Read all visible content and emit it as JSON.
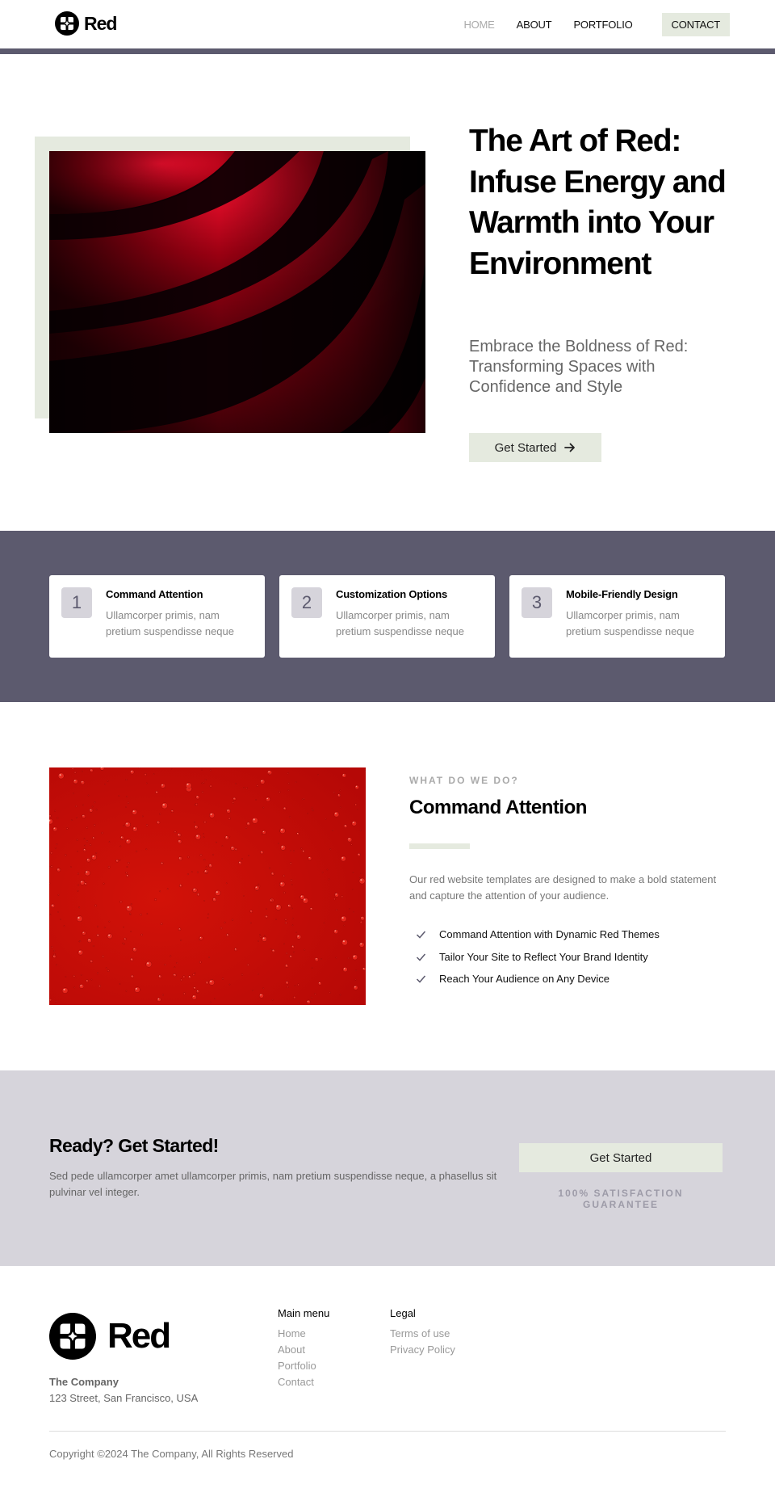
{
  "header": {
    "brand": "Red",
    "nav": [
      {
        "label": "HOME",
        "active": true
      },
      {
        "label": "ABOUT",
        "active": false
      },
      {
        "label": "PORTFOLIO",
        "active": false
      },
      {
        "label": "CONTACT",
        "active": false
      }
    ]
  },
  "hero": {
    "title": "The Art of Red: Infuse Energy and Warmth into Your Environment",
    "subtitle": "Embrace the Boldness of Red: Transforming Spaces with Confidence and Style",
    "cta_label": "Get Started",
    "cta_icon": "arrow-right-icon",
    "image": "abstract-red-curves"
  },
  "features": [
    {
      "number": "1",
      "title": "Command Attention",
      "description": "Ullamcorper primis, nam pretium suspendisse neque"
    },
    {
      "number": "2",
      "title": "Customization Options",
      "description": "Ullamcorper primis, nam pretium suspendisse neque"
    },
    {
      "number": "3",
      "title": "Mobile-Friendly Design",
      "description": "Ullamcorper primis, nam pretium suspendisse neque"
    }
  ],
  "about": {
    "image": "red-water-droplets",
    "eyebrow": "WHAT DO WE DO?",
    "title": "Command Attention",
    "text": "Our red website templates are designed to make a bold statement and capture the attention of your audience.",
    "checklist": [
      "Command Attention with Dynamic Red Themes",
      "Tailor Your Site to Reflect Your Brand Identity",
      "Reach Your Audience on Any Device"
    ]
  },
  "cta": {
    "title": "Ready? Get Started!",
    "text": "Sed pede ullamcorper amet ullamcorper primis, nam pretium suspendisse neque, a phasellus sit pulvinar vel integer.",
    "button_label": "Get Started",
    "guarantee": "100% SATISFACTION GUARANTEE"
  },
  "footer": {
    "brand": "Red",
    "company": "The Company",
    "address": "123 Street, San Francisco, USA",
    "main_menu": {
      "heading": "Main menu",
      "links": [
        "Home",
        "About",
        "Portfolio",
        "Contact"
      ]
    },
    "legal": {
      "heading": "Legal",
      "links": [
        "Terms of use",
        "Privacy Policy"
      ]
    },
    "copyright": "Copyright ©2024 The Company, All Rights Reserved"
  },
  "colors": {
    "accent_light": "#e5eadf",
    "band_dark": "#5c5a6e",
    "band_light": "#d6d4db",
    "text_muted": "#777777"
  }
}
